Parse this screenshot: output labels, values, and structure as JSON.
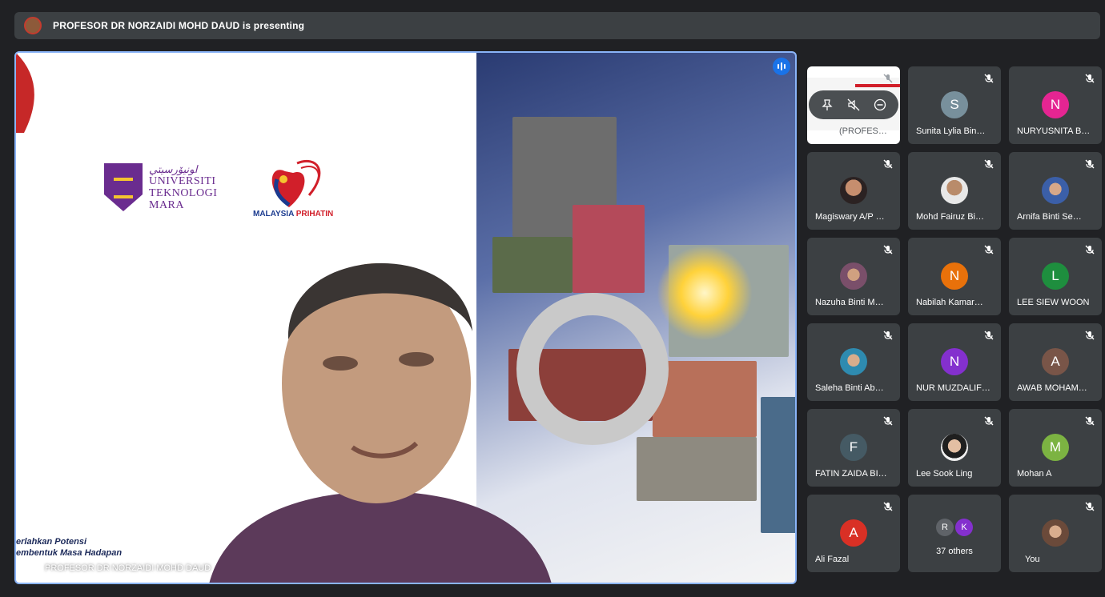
{
  "topbar": {
    "title": "PROFESOR DR NORZAIDI MOHD DAUD is presenting"
  },
  "presenter": {
    "name": "PROFESOR DR NORZAIDI MOHD DAUD"
  },
  "slide": {
    "uni_jawi": "ﺍﻮﻧﻴﯚﺭﺳﻴﺘﻲ",
    "uni_lines": [
      "UNIVERSITI",
      "TEKNOLOGI",
      "MARA"
    ],
    "prihatin_a": "MALAYSIA",
    "prihatin_b": "PRIHATIN",
    "footer_lines": [
      "erlahkan Potensi",
      "embentuk Masa Hadapan"
    ]
  },
  "participants": [
    {
      "name": "(PROFES…",
      "type": "self-screen"
    },
    {
      "name": "Sunita Lylia Bin…",
      "initial": "S",
      "color": "#78909c"
    },
    {
      "name": "NURYUSNITA B…",
      "initial": "N",
      "color": "#e52592"
    },
    {
      "name": "Magiswary A/P …",
      "photo": true
    },
    {
      "name": "Mohd Fairuz Bi…",
      "photo": true
    },
    {
      "name": "Arnifa Binti Se…",
      "photo": true
    },
    {
      "name": "Nazuha Binti M…",
      "photo": true
    },
    {
      "name": "Nabilah Kamar…",
      "initial": "N",
      "color": "#e8710a"
    },
    {
      "name": "LEE SIEW WOON",
      "initial": "L",
      "color": "#1e8e3e"
    },
    {
      "name": "Saleha Binti Ab…",
      "photo": true
    },
    {
      "name": "NUR MUZDALIF…",
      "initial": "N",
      "color": "#8430ce"
    },
    {
      "name": "AWAB MOHAM…",
      "initial": "A",
      "color": "#795548"
    },
    {
      "name": "FATIN ZAIDA BI…",
      "initial": "F",
      "color": "#455a64"
    },
    {
      "name": "Lee Sook Ling",
      "photo": true
    },
    {
      "name": "Mohan A",
      "initial": "M",
      "color": "#7cb342"
    },
    {
      "name": "Ali Fazal",
      "initial": "A",
      "color": "#d93025"
    },
    {
      "name": "37 others",
      "type": "others",
      "initials": [
        "R",
        "K"
      ],
      "colors": [
        "#5f6368",
        "#8430ce"
      ]
    },
    {
      "name": "You",
      "photo": true
    }
  ]
}
